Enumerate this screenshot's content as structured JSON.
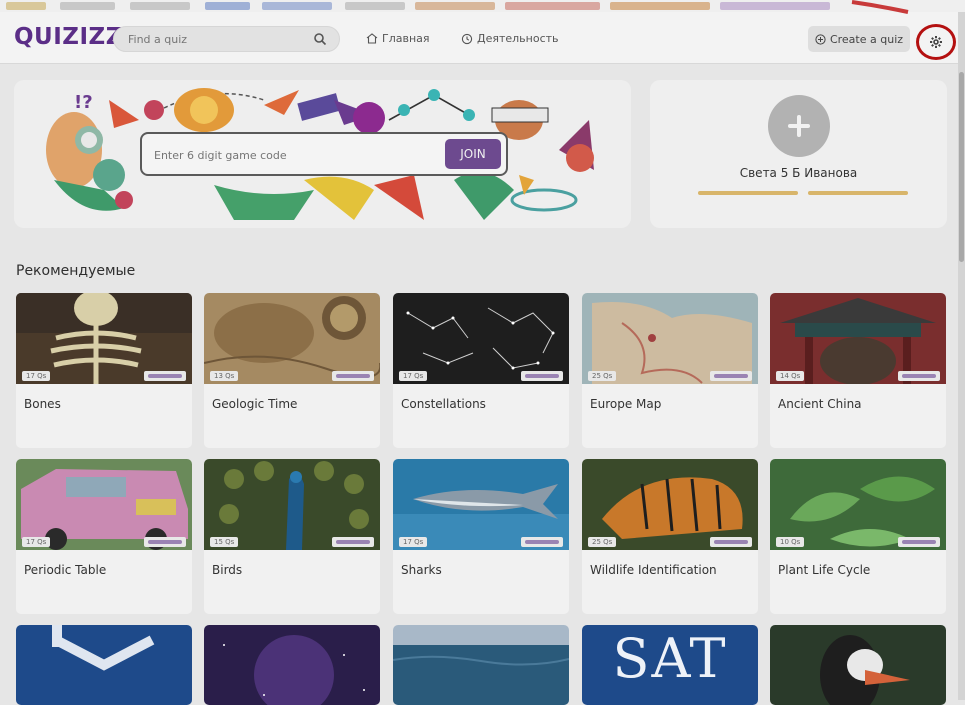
{
  "header": {
    "logo": "QUIZIZZ",
    "search": {
      "placeholder": "Find a quiz"
    },
    "nav": [
      {
        "label": "Главная",
        "icon": "home-icon"
      },
      {
        "label": "Деятельность",
        "icon": "history-icon"
      }
    ],
    "create_label": "Create a quiz",
    "settings_icon": "gear-icon"
  },
  "banner": {
    "join": {
      "placeholder": "Enter 6 digit game code",
      "button_label": "JOIN"
    }
  },
  "profile": {
    "name": "Света 5 Б Иванова"
  },
  "section": {
    "title": "Рекомендуемые"
  },
  "quizzes": [
    {
      "title": "Bones",
      "qs": "17 Qs"
    },
    {
      "title": "Geologic Time",
      "qs": "13 Qs"
    },
    {
      "title": "Constellations",
      "qs": "17 Qs"
    },
    {
      "title": "Europe Map",
      "qs": "25 Qs"
    },
    {
      "title": "Ancient China",
      "qs": "14 Qs"
    },
    {
      "title": "Periodic Table",
      "qs": "17 Qs"
    },
    {
      "title": "Birds",
      "qs": "15 Qs"
    },
    {
      "title": "Sharks",
      "qs": "17 Qs"
    },
    {
      "title": "Wildlife Identification",
      "qs": "25 Qs"
    },
    {
      "title": "Plant Life Cycle",
      "qs": "10 Qs"
    }
  ],
  "bottom_row": [
    {
      "label": ""
    },
    {
      "label": ""
    },
    {
      "label": ""
    },
    {
      "label": "SAT"
    },
    {
      "label": ""
    }
  ],
  "colors": {
    "brand": "#5b2e87",
    "join_button": "#6d4a8f",
    "highlight_ring": "#b41010"
  }
}
